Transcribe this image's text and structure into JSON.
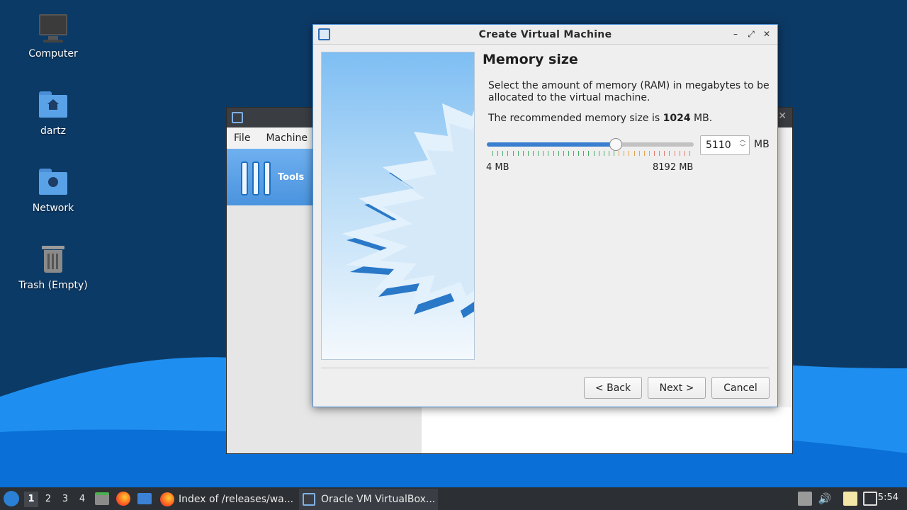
{
  "desktop": {
    "icons": [
      {
        "label": "Computer",
        "icon": "computer-icon"
      },
      {
        "label": "dartz",
        "icon": "home-folder-icon"
      },
      {
        "label": "Network",
        "icon": "network-folder-icon"
      },
      {
        "label": "Trash (Empty)",
        "icon": "trash-icon"
      }
    ]
  },
  "bg_window": {
    "menu": [
      "File",
      "Machine"
    ],
    "tools_label": "Tools"
  },
  "dialog": {
    "title": "Create Virtual Machine",
    "page_title": "Memory size",
    "description": "Select the amount of memory (RAM) in megabytes to be allocated to the virtual machine.",
    "recommend_prefix": "The recommended memory size is ",
    "recommend_value": "1024",
    "recommend_suffix": " MB.",
    "memory": {
      "value": "5110",
      "unit": "MB",
      "min_label": "4 MB",
      "max_label": "8192 MB",
      "min": 4,
      "max": 8192,
      "current": 5110
    },
    "buttons": {
      "back": "< Back",
      "next": "Next >",
      "cancel": "Cancel"
    }
  },
  "taskbar": {
    "workspaces": [
      "1",
      "2",
      "3",
      "4"
    ],
    "tasks": [
      {
        "label": "Index of /releases/wa...",
        "icon": "firefox-icon"
      },
      {
        "label": "Oracle VM VirtualBox...",
        "icon": "virtualbox-icon"
      }
    ],
    "clock": "5:54"
  },
  "colors": {
    "accent": "#3a7fcf",
    "wallpaper": "#0c3a66",
    "wave": "#1e8ff0",
    "taskbar": "#2c2f33"
  }
}
